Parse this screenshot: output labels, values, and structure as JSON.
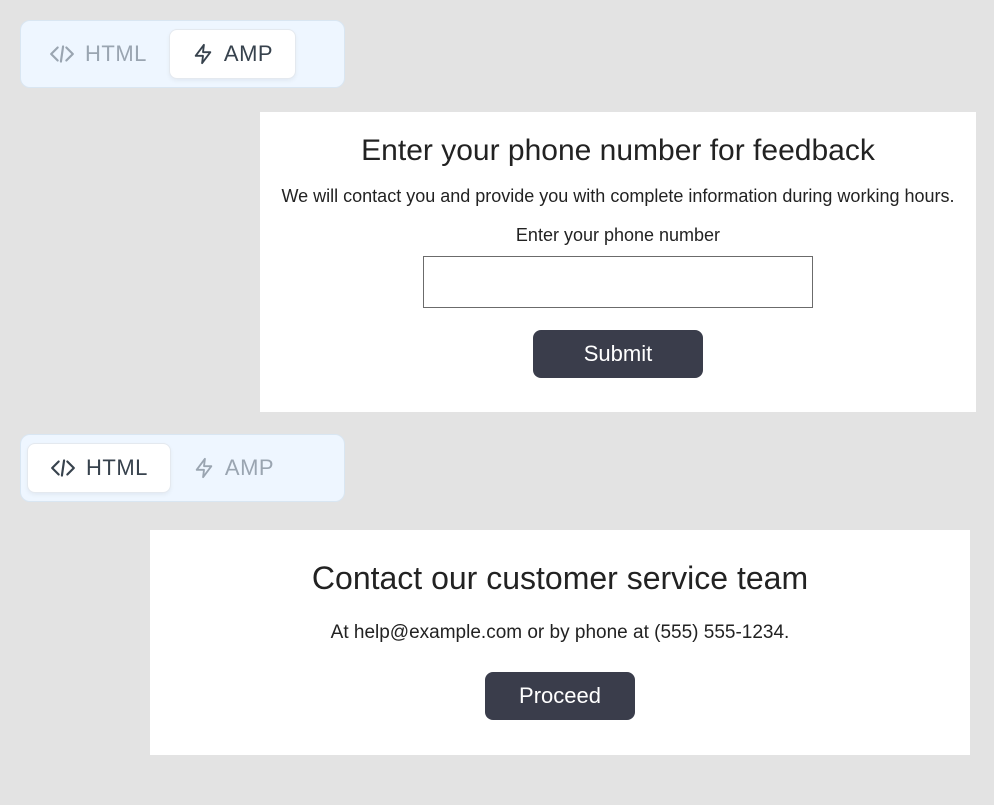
{
  "switcher1": {
    "tabs": {
      "html": "HTML",
      "amp": "AMP"
    },
    "active": "amp"
  },
  "switcher2": {
    "tabs": {
      "html": "HTML",
      "amp": "AMP"
    },
    "active": "html"
  },
  "card1": {
    "title": "Enter your phone number for feedback",
    "subtitle": "We will contact you and provide you with complete information during working hours.",
    "field_label": "Enter your phone number",
    "input_value": "",
    "submit_label": "Submit"
  },
  "card2": {
    "title": "Contact our customer service team",
    "subtitle": "At help@example.com or by phone at (555) 555-1234.",
    "button_label": "Proceed"
  },
  "colors": {
    "button_bg": "#3a3d4b",
    "switch_bg": "#eef6ff",
    "page_bg": "#e3e3e3"
  }
}
